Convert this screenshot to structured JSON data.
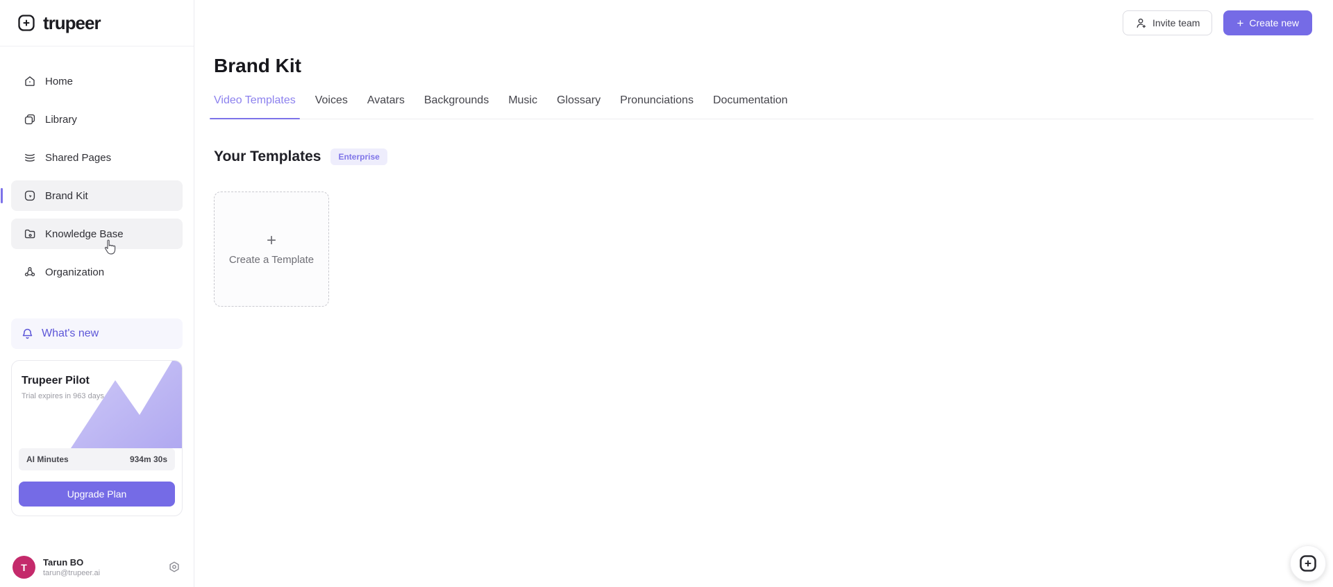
{
  "brand": {
    "name": "trupeer"
  },
  "colors": {
    "accent": "#756be6",
    "active_tab": "#8c81ee",
    "whats_new": "#5d57d8",
    "avatar": "#c42a6b",
    "pilot_graph": "#aaa1f0"
  },
  "sidebar": {
    "items": [
      {
        "label": "Home"
      },
      {
        "label": "Library"
      },
      {
        "label": "Shared Pages"
      },
      {
        "label": "Brand Kit",
        "state": "active"
      },
      {
        "label": "Knowledge Base",
        "state": "hovered"
      },
      {
        "label": "Organization"
      }
    ],
    "whats_new_label": "What's new",
    "pilot": {
      "title": "Trupeer Pilot",
      "subtitle": "Trial expires in 963 days",
      "ai_minutes_label": "AI Minutes",
      "ai_minutes_value": "934m 30s",
      "upgrade_label": "Upgrade Plan"
    },
    "user": {
      "name": "Tarun BO",
      "email": "tarun@trupeer.ai",
      "avatar_initial": "T"
    }
  },
  "topbar": {
    "invite_label": "Invite team",
    "create_label": "Create new",
    "create_plus": "+"
  },
  "main": {
    "title": "Brand Kit",
    "tabs": [
      {
        "label": "Video Templates",
        "active": true
      },
      {
        "label": "Voices"
      },
      {
        "label": "Avatars"
      },
      {
        "label": "Backgrounds"
      },
      {
        "label": "Music"
      },
      {
        "label": "Glossary"
      },
      {
        "label": "Pronunciations"
      },
      {
        "label": "Documentation"
      }
    ],
    "section": {
      "title": "Your Templates",
      "badge": "Enterprise",
      "create_tile": {
        "plus": "+",
        "label": "Create a Template"
      }
    }
  }
}
